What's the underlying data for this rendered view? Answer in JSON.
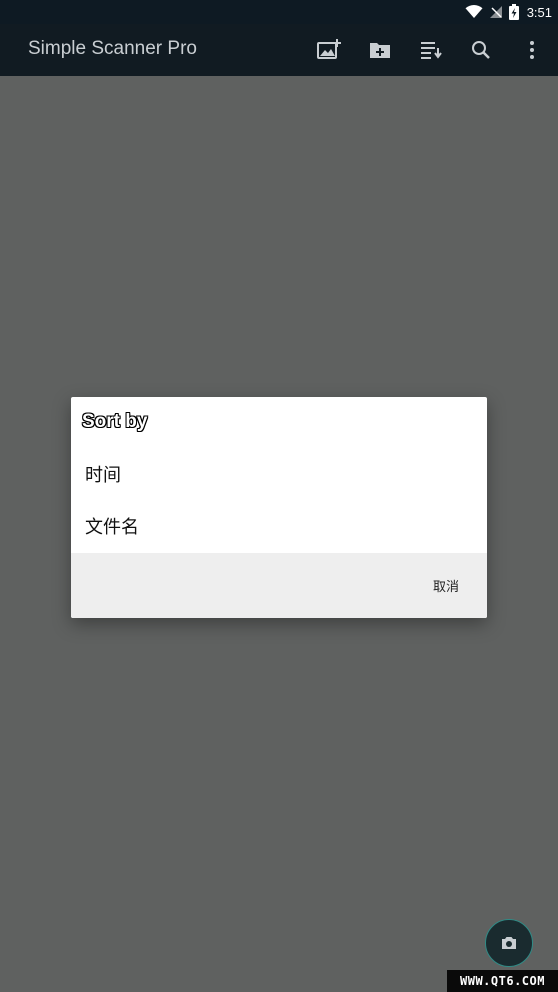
{
  "status_bar": {
    "time": "3:51"
  },
  "app_bar": {
    "title": "Simple Scanner Pro",
    "actions": [
      "add-image-icon",
      "new-folder-icon",
      "sort-icon",
      "search-icon",
      "more-vert-icon"
    ]
  },
  "dialog": {
    "title": "Sort by",
    "options": [
      {
        "label": "时间"
      },
      {
        "label": "文件名"
      }
    ],
    "cancel_label": "取消"
  },
  "fab": {
    "icon": "camera-icon"
  },
  "watermark": {
    "text": "WWW.QT6.COM"
  },
  "colors": {
    "status_bar": "#0e1a23",
    "app_bar": "#111b22",
    "scrim": "#5f6160",
    "dialog_bg": "#ffffff",
    "dialog_footer": "#eeeeee",
    "fab_bg": "#1a2b2f",
    "fab_border": "#2f8b86"
  }
}
